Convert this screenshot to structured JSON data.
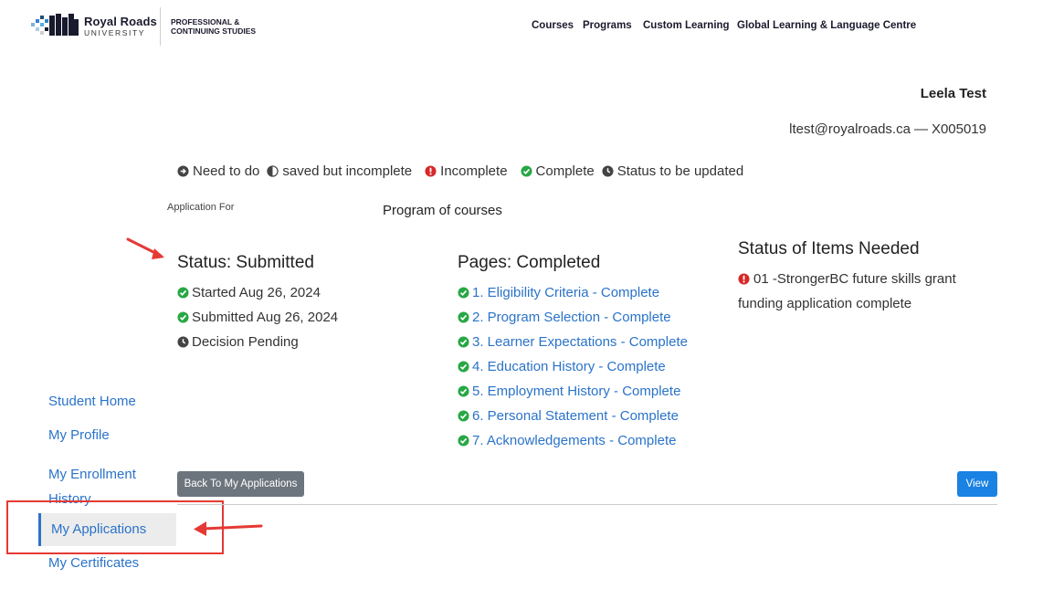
{
  "header": {
    "logo_name": "Royal Roads",
    "logo_subtitle": "UNIVERSITY",
    "unit_line1": "PROFESSIONAL &",
    "unit_line2": "CONTINUING STUDIES",
    "nav": [
      "Courses",
      "Programs",
      "Custom Learning",
      "Global Learning & Language Centre"
    ]
  },
  "user": {
    "name": "Leela Test",
    "email": "ltest@royalroads.ca",
    "separator": "—",
    "id": "X005019"
  },
  "legend": [
    {
      "icon": "arrow-circle-icon",
      "label": "Need to do"
    },
    {
      "icon": "half-circle-icon",
      "label": "saved but incomplete"
    },
    {
      "icon": "exclamation-circle-icon",
      "label": "Incomplete"
    },
    {
      "icon": "check-circle-icon",
      "label": "Complete"
    },
    {
      "icon": "clock-icon",
      "label": "Status to be updated"
    }
  ],
  "application": {
    "for_label": "Application For",
    "for_value": "Program of courses"
  },
  "status": {
    "title": "Status: Submitted",
    "items": [
      "Started Aug 26, 2024",
      "Submitted Aug 26, 2024",
      "Decision Pending"
    ]
  },
  "pages": {
    "title": "Pages: Completed",
    "items": [
      "1. Eligibility Criteria - Complete",
      "2. Program Selection - Complete",
      "3. Learner Expectations - Complete",
      "4. Education History - Complete",
      "5. Employment History - Complete",
      "6. Personal Statement - Complete",
      "7. Acknowledgements - Complete"
    ]
  },
  "items_needed": {
    "title": "Status of Items Needed",
    "items": [
      "01 -StrongerBC future skills grant funding application complete"
    ]
  },
  "sidebar": {
    "items": [
      "Student Home",
      "My Profile",
      "My Enrollment History",
      "My Applications",
      "My Certificates"
    ],
    "active": "My Applications"
  },
  "buttons": {
    "back": "Back To My Applications",
    "view": "View"
  },
  "colors": {
    "link": "#2a73c9",
    "complete": "#28a745",
    "incomplete": "#d62828",
    "annotation": "#e53935"
  }
}
